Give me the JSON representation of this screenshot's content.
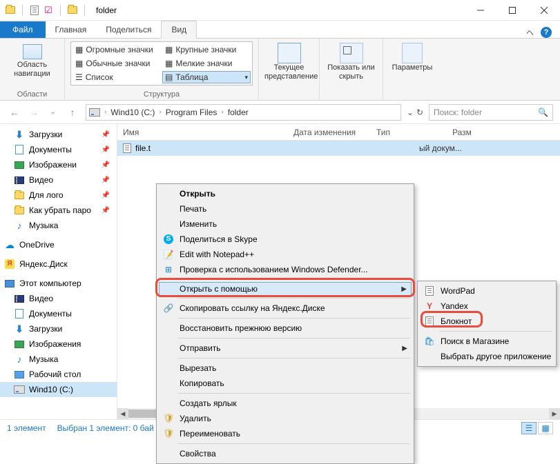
{
  "title": "folder",
  "tabs": {
    "file": "Файл",
    "home": "Главная",
    "share": "Поделиться",
    "view": "Вид"
  },
  "ribbon": {
    "nav": {
      "label": "Область навигации",
      "group": "Области"
    },
    "layout": {
      "huge": "Огромные значки",
      "large": "Крупные значки",
      "medium": "Обычные значки",
      "small": "Мелкие значки",
      "list": "Список",
      "details": "Таблица",
      "group": "Структура"
    },
    "current_view": "Текущее представление",
    "show_hide": "Показать или скрыть",
    "params": "Параметры"
  },
  "breadcrumb": [
    "Wind10 (C:)",
    "Program Files",
    "folder"
  ],
  "search_placeholder": "Поиск: folder",
  "columns": {
    "name": "Имя",
    "date": "Дата изменения",
    "type": "Тип",
    "size": "Разм"
  },
  "file": {
    "name": "file.t",
    "type_trunc": "ый докум..."
  },
  "sidebar": {
    "quick": [
      {
        "label": "Загрузки",
        "pinned": true,
        "icon": "dl"
      },
      {
        "label": "Документы",
        "pinned": true,
        "icon": "doc"
      },
      {
        "label": "Изображени",
        "pinned": true,
        "icon": "pic"
      },
      {
        "label": "Видео",
        "pinned": true,
        "icon": "video"
      },
      {
        "label": "Для лого",
        "pinned": true,
        "icon": "folder"
      },
      {
        "label": "Как убрать паро",
        "pinned": true,
        "icon": "folder"
      },
      {
        "label": "Музыка",
        "pinned": false,
        "icon": "music"
      }
    ],
    "onedrive": "OneDrive",
    "yadisk": "Яндекс.Диск",
    "pc": "Этот компьютер",
    "pc_items": [
      {
        "label": "Видео",
        "icon": "video"
      },
      {
        "label": "Документы",
        "icon": "doc"
      },
      {
        "label": "Загрузки",
        "icon": "dl"
      },
      {
        "label": "Изображения",
        "icon": "pic"
      },
      {
        "label": "Музыка",
        "icon": "music"
      },
      {
        "label": "Рабочий стол",
        "icon": "desk"
      },
      {
        "label": "Wind10 (C:)",
        "icon": "drive",
        "selected": true
      }
    ]
  },
  "context_menu": [
    {
      "label": "Открыть",
      "bold": true
    },
    {
      "label": "Печать"
    },
    {
      "label": "Изменить"
    },
    {
      "label": "Поделиться в Skype",
      "icon": "skype"
    },
    {
      "label": "Edit with Notepad++",
      "icon": "npp"
    },
    {
      "label": "Проверка с использованием Windows Defender...",
      "icon": "defender"
    },
    {
      "sep": true
    },
    {
      "label": "Открыть с помощью",
      "submenu": true,
      "highlight": true
    },
    {
      "sep": true
    },
    {
      "label": "Скопировать ссылку на Яндекс.Диске",
      "icon": "link"
    },
    {
      "sep": true
    },
    {
      "label": "Восстановить прежнюю версию"
    },
    {
      "sep": true
    },
    {
      "label": "Отправить",
      "submenu": true
    },
    {
      "sep": true
    },
    {
      "label": "Вырезать"
    },
    {
      "label": "Копировать"
    },
    {
      "sep": true
    },
    {
      "label": "Создать ярлык"
    },
    {
      "label": "Удалить",
      "icon": "shield"
    },
    {
      "label": "Переименовать",
      "icon": "shield"
    },
    {
      "sep": true
    },
    {
      "label": "Свойства"
    }
  ],
  "submenu": [
    {
      "label": "WordPad",
      "icon": "wordpad"
    },
    {
      "label": "Yandex",
      "icon": "yandex"
    },
    {
      "label": "Блокнот",
      "icon": "notepad",
      "highlight_red": true
    },
    {
      "sep": true
    },
    {
      "label": "Поиск в Магазине",
      "icon": "store"
    },
    {
      "label": "Выбрать другое приложение"
    }
  ],
  "status": {
    "count": "1 элемент",
    "selection": "Выбран 1 элемент: 0 бай"
  }
}
